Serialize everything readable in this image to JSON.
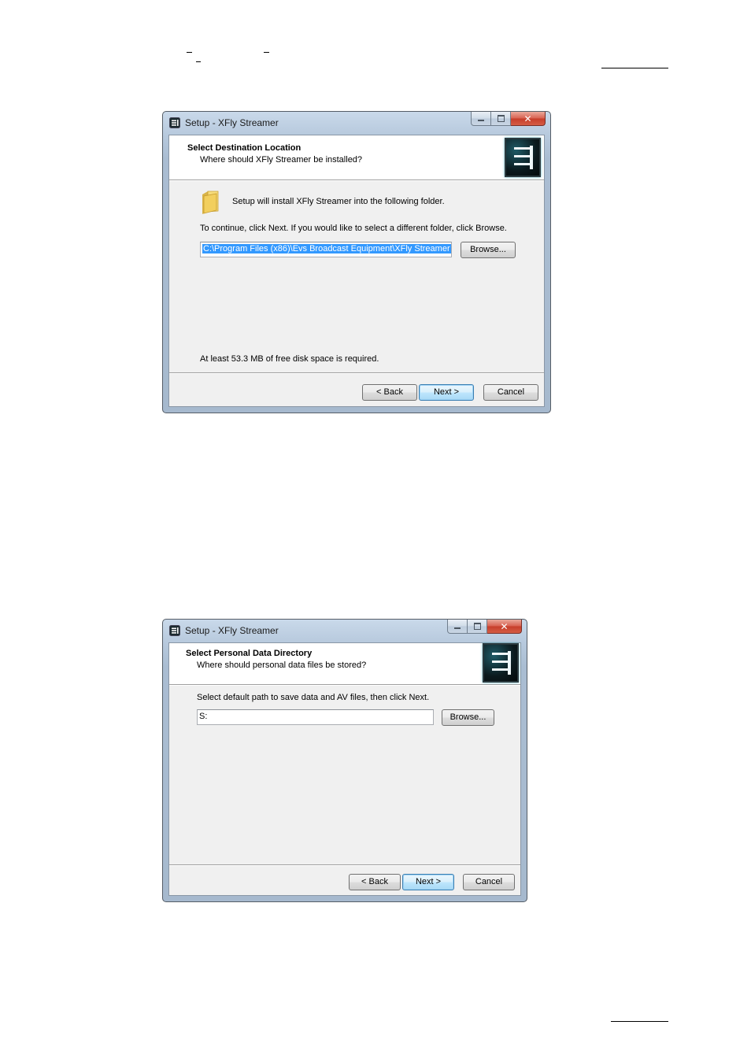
{
  "dialog1": {
    "title": "Setup - XFly Streamer",
    "header_title": "Select Destination Location",
    "header_subtitle": "Where should XFly Streamer be installed?",
    "intro": "Setup will install XFly Streamer into the following folder.",
    "instruction": "To continue, click Next. If you would like to select a different folder, click Browse.",
    "path_value": "C:\\Program Files (x86)\\Evs Broadcast Equipment\\XFly Streamer",
    "browse_label": "Browse...",
    "disk_space": "At least 53.3 MB of free disk space is required.",
    "back_label": "< Back",
    "next_label": "Next >",
    "cancel_label": "Cancel"
  },
  "dialog2": {
    "title": "Setup - XFly Streamer",
    "header_title": "Select Personal Data Directory",
    "header_subtitle": "Where should personal data files be stored?",
    "instruction": "Select default path to save data and AV files, then click Next.",
    "path_value": "S:",
    "browse_label": "Browse...",
    "back_label": "< Back",
    "next_label": "Next >",
    "cancel_label": "Cancel"
  },
  "colors": {
    "selection": "#3399ff",
    "close_button": "#c63d2a",
    "dialog_background": "#f0f0f0"
  }
}
